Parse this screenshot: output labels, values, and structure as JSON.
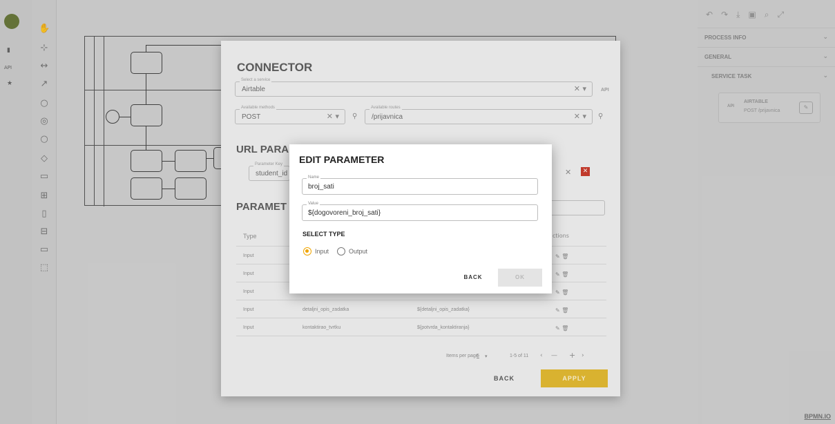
{
  "left_rail": {
    "icons": [
      "logo-icon",
      "file-icon",
      "api-icon",
      "star-icon"
    ],
    "api_label": "API"
  },
  "palette": {
    "tools": [
      "hand-tool-icon",
      "lasso-tool-icon",
      "space-tool-icon",
      "connect-tool-icon",
      "start-event-icon",
      "intermediate-event-icon",
      "end-event-icon",
      "gateway-icon",
      "task-icon",
      "subprocess-icon",
      "data-object-icon",
      "data-store-icon",
      "pool-icon",
      "group-icon"
    ]
  },
  "properties_panel": {
    "toolbar_icons": [
      "undo-icon",
      "redo-icon",
      "download-icon",
      "save-icon",
      "search-icon",
      "fullscreen-icon"
    ],
    "sections": [
      "PROCESS INFO",
      "GENERAL",
      "SERVICE TASK"
    ],
    "service_card": {
      "api": "API",
      "name": "AIRTABLE",
      "route": "POST /prijavnica"
    },
    "footer": "BPMN.IO"
  },
  "connector": {
    "title": "CONNECTOR",
    "service": {
      "label": "Select a service",
      "value": "Airtable",
      "api_tag": "API"
    },
    "method": {
      "label": "Available methods",
      "value": "POST"
    },
    "route": {
      "label": "Available routes",
      "value": "/prijavnica"
    },
    "url_title": "URL PARA",
    "url_param": {
      "label": "Parameter Key",
      "value": "student_id"
    },
    "params_title": "PARAMET",
    "table": {
      "headers": [
        "Type",
        "",
        "",
        "ctions"
      ],
      "rows": [
        {
          "type": "Input",
          "name": "",
          "value": ""
        },
        {
          "type": "Input",
          "name": "",
          "value": ""
        },
        {
          "type": "Input",
          "name": "",
          "value": ""
        },
        {
          "type": "Input",
          "name": "detaljni_opis_zadatka",
          "value": "${detaljni_opis_zadatka}"
        },
        {
          "type": "Input",
          "name": "kontaktirao_tvrtku",
          "value": "${potvrda_kontaktiranja}"
        }
      ]
    },
    "pager": {
      "items_label": "Items per page",
      "per_page": "5",
      "range": "1-5 of 11"
    },
    "back": "BACK",
    "apply": "APPLY"
  },
  "edit_dialog": {
    "title": "EDIT PARAMETER",
    "name": {
      "label": "Name",
      "value": "broj_sati"
    },
    "value": {
      "label": "Value",
      "value": "${dogovoreni_broj_sati}"
    },
    "select_type": "SELECT TYPE",
    "options": [
      {
        "label": "Input",
        "selected": true
      },
      {
        "label": "Output",
        "selected": false
      }
    ],
    "back": "BACK",
    "ok": "OK"
  },
  "colors": {
    "accent": "#f0a500",
    "apply_bg": "#d9b230",
    "danger": "#c0392b"
  }
}
